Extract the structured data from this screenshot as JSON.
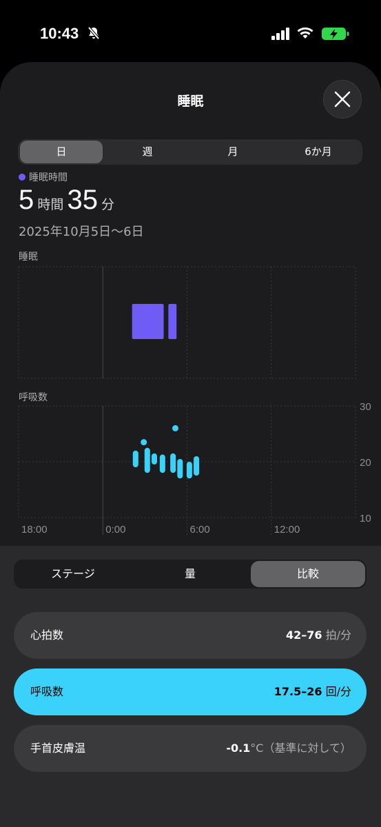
{
  "status": {
    "time": "10:43"
  },
  "sheet": {
    "title": "睡眠",
    "tabs": [
      "日",
      "週",
      "月",
      "6か月"
    ],
    "selected_tab": "日",
    "legend": "睡眠時間",
    "duration": {
      "hours": "5",
      "hours_unit": "時間",
      "minutes": "35",
      "minutes_unit": "分"
    },
    "date_range": "2025年10月5日〜6日",
    "sleep_label": "睡眠",
    "resp_label": "呼吸数"
  },
  "chart_data": [
    {
      "type": "bar",
      "title": "睡眠",
      "x_ticks": [
        "18:00",
        "0:00",
        "6:00",
        "12:00"
      ],
      "series": [
        {
          "start": "2:05",
          "end": "4:20",
          "value": 1
        },
        {
          "start": "4:40",
          "end": "5:15",
          "value": 1
        }
      ],
      "color": "#6e5cf5"
    },
    {
      "type": "scatter",
      "title": "呼吸数",
      "x_ticks": [
        "18:00",
        "0:00",
        "6:00",
        "12:00"
      ],
      "y_ticks": [
        "30",
        "20",
        "10"
      ],
      "ylim": [
        10,
        30
      ],
      "ranges": [
        {
          "x": "2:20",
          "low": 19.5,
          "high": 21.5
        },
        {
          "x": "3:10",
          "low": 18.5,
          "high": 22.0
        },
        {
          "x": "3:40",
          "low": 20.0,
          "high": 21.0
        },
        {
          "x": "4:15",
          "low": 18.5,
          "high": 20.8
        },
        {
          "x": "5:00",
          "low": 18.5,
          "high": 21.0
        },
        {
          "x": "5:30",
          "low": 17.5,
          "high": 20.0
        },
        {
          "x": "6:10",
          "low": 17.5,
          "high": 19.5
        },
        {
          "x": "6:40",
          "low": 18.0,
          "high": 20.5
        }
      ],
      "points": [
        {
          "x": "2:55",
          "y": 23.5
        },
        {
          "x": "5:10",
          "y": 26.0
        }
      ],
      "color": "#3ad2fa"
    }
  ],
  "bottom": {
    "tabs": [
      "ステージ",
      "量",
      "比較"
    ],
    "selected_tab": "比較",
    "rows": [
      {
        "name": "心拍数",
        "value": "42–76",
        "unit": " 拍/分"
      },
      {
        "name": "呼吸数",
        "value": "17.5–26",
        "unit": " 回/分"
      },
      {
        "name": "手首皮膚温",
        "value": "-0.1",
        "unit": "°C（基準に対して）"
      }
    ]
  }
}
